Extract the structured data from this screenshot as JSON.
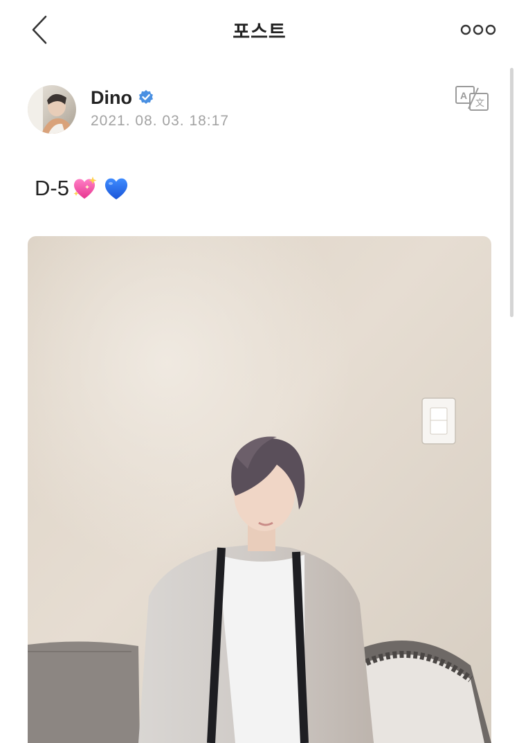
{
  "header": {
    "title": "포스트",
    "back_icon": "chevron-left-icon",
    "more_icon": "more-horizontal-icon"
  },
  "post": {
    "author": {
      "name": "Dino",
      "verified": true,
      "verified_color": "#4a90e2"
    },
    "timestamp": "2021. 08. 03. 18:17",
    "translate_icon": "translate-icon",
    "text": "D-5",
    "emojis": [
      "sparkling-heart-emoji",
      "blue-heart-emoji"
    ]
  },
  "colors": {
    "text_primary": "#222222",
    "text_secondary": "#a2a2a2",
    "icon_gray": "#9a9a9a"
  }
}
